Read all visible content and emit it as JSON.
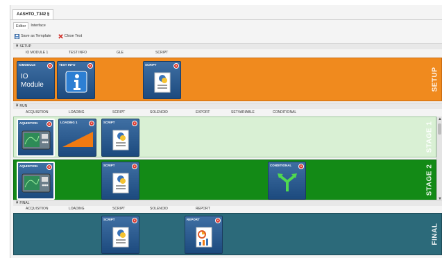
{
  "document_tab": "AASHTO_T342 §",
  "subtabs": [
    "Editor",
    "Interface"
  ],
  "toolbar": {
    "save_template": "Save as Template",
    "close_test": "Close Test"
  },
  "colors": {
    "setup": "#f08a1e",
    "stage1": "#d9f0d4",
    "stage2": "#138a16",
    "final": "#2c6a7a"
  },
  "setup": {
    "header": "SETUP",
    "columns": [
      "IO MODULE 1",
      "TEST INFO",
      "GLE",
      "SCRIPT"
    ],
    "label": "SETUP",
    "blocks": {
      "io_module": {
        "label": "IOMODULE",
        "line1": "IO",
        "line2": "Module"
      },
      "test_info": {
        "label": "TEST INFO"
      },
      "script": {
        "label": "SCRIPT"
      }
    }
  },
  "run": {
    "header": "RUN",
    "columns": [
      "ACQUISITION",
      "LOADING",
      "SCRIPT",
      "SOLENOID",
      "EXPORT",
      "SETVARIABLE",
      "CONDITIONAL"
    ],
    "stage1": {
      "label": "STAGE 1",
      "blocks": {
        "acquisition": "AQUISITION",
        "loading": "LOADING 1",
        "script": "SCRIPT"
      }
    },
    "stage2": {
      "label": "STAGE 2",
      "blocks": {
        "acquisition": "AQUISITION",
        "script": "SCRIPT",
        "conditional": "CONDITIONAL"
      }
    }
  },
  "final": {
    "header": "FINAL",
    "columns": [
      "ACQUISITION",
      "LOADING",
      "SCRIPT",
      "SOLENOID",
      "REPORT"
    ],
    "label": "FINAL",
    "blocks": {
      "script": "SCRIPT",
      "report": "REPORT"
    }
  },
  "close_symbol": "×"
}
